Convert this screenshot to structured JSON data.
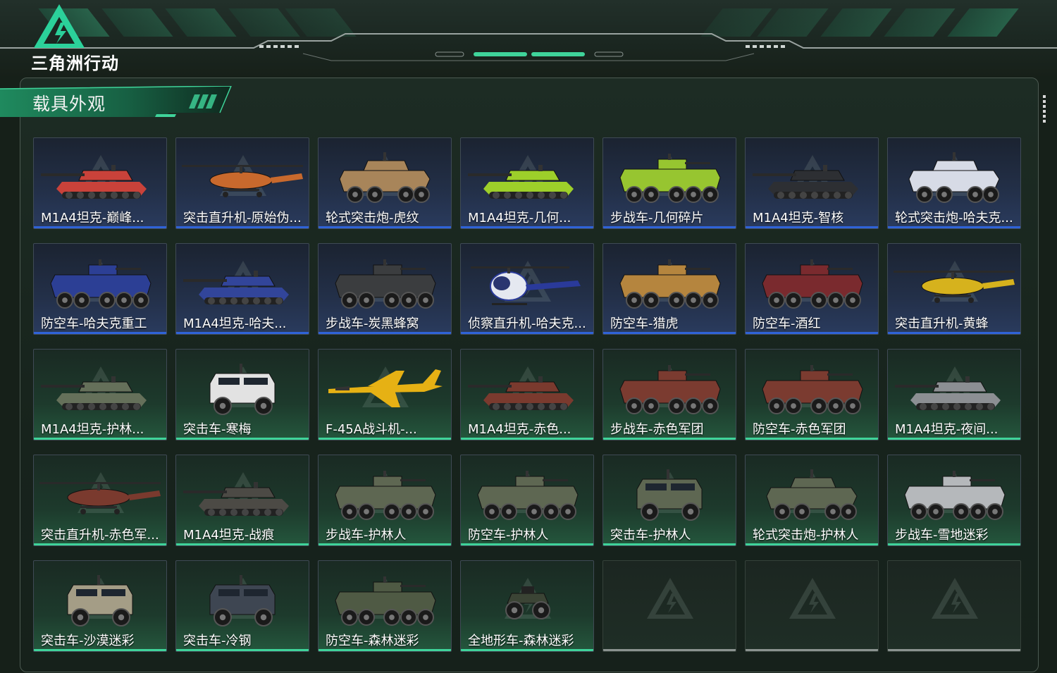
{
  "game": {
    "logo_text": "三角洲行动"
  },
  "panel": {
    "title": "载具外观"
  },
  "colors": {
    "rare_blue": "#2f63d8",
    "epic_green": "#3fd49a",
    "empty_gray": "#8b9390",
    "brand_green": "#2bd19a"
  },
  "vehicles": [
    {
      "name": "M1A4坦克-巅峰...",
      "rarity": "blue",
      "kind": "tank",
      "paint": "#c9423a"
    },
    {
      "name": "突击直升机-原始伪...",
      "rarity": "blue",
      "kind": "heli",
      "paint": "#c8692d"
    },
    {
      "name": "轮式突击炮-虎纹",
      "rarity": "blue",
      "kind": "wheeled4",
      "paint": "#a8855a"
    },
    {
      "name": "M1A4坦克-几何...",
      "rarity": "blue",
      "kind": "tank",
      "paint": "#9dcf2a"
    },
    {
      "name": "步战车-几何碎片",
      "rarity": "blue",
      "kind": "apc",
      "paint": "#97c530"
    },
    {
      "name": "M1A4坦克-智核",
      "rarity": "blue",
      "kind": "tank",
      "paint": "#2d2f33"
    },
    {
      "name": "轮式突击炮-哈夫克...",
      "rarity": "blue",
      "kind": "wheeled4",
      "paint": "#d7dbe6"
    },
    {
      "name": "防空车-哈夫克重工",
      "rarity": "blue",
      "kind": "apc",
      "paint": "#2c3f95"
    },
    {
      "name": "M1A4坦克-哈夫...",
      "rarity": "blue",
      "kind": "tank",
      "paint": "#32459a"
    },
    {
      "name": "步战车-炭黑蜂窝",
      "rarity": "blue",
      "kind": "apc",
      "paint": "#3b3d3f"
    },
    {
      "name": "侦察直升机-哈夫克...",
      "rarity": "blue",
      "kind": "scout",
      "paint": "#e5e8f0"
    },
    {
      "name": "防空车-猎虎",
      "rarity": "blue",
      "kind": "apc",
      "paint": "#b5853e"
    },
    {
      "name": "防空车-酒红",
      "rarity": "blue",
      "kind": "apc",
      "paint": "#7a2a2e"
    },
    {
      "name": "突击直升机-黄蜂",
      "rarity": "blue",
      "kind": "heli",
      "paint": "#d6b21d"
    },
    {
      "name": "M1A4坦克-护林...",
      "rarity": "green",
      "kind": "tank",
      "paint": "#65705a"
    },
    {
      "name": "突击车-寒梅",
      "rarity": "green",
      "kind": "truck",
      "paint": "#e2e2e2"
    },
    {
      "name": "F-45A战斗机-...",
      "rarity": "green",
      "kind": "jet",
      "paint": "#e6b114"
    },
    {
      "name": "M1A4坦克-赤色...",
      "rarity": "green",
      "kind": "tank",
      "paint": "#7a3a2e"
    },
    {
      "name": "步战车-赤色军团",
      "rarity": "green",
      "kind": "apc",
      "paint": "#7b3b30"
    },
    {
      "name": "防空车-赤色军团",
      "rarity": "green",
      "kind": "apc",
      "paint": "#7b3b30"
    },
    {
      "name": "M1A4坦克-夜间...",
      "rarity": "green",
      "kind": "tank",
      "paint": "#8c8f93"
    },
    {
      "name": "突击直升机-赤色军...",
      "rarity": "green",
      "kind": "heli",
      "paint": "#7a3a2e"
    },
    {
      "name": "M1A4坦克-战痕",
      "rarity": "green",
      "kind": "tank",
      "paint": "#4c4a45"
    },
    {
      "name": "步战车-护林人",
      "rarity": "green",
      "kind": "apc",
      "paint": "#5e6752"
    },
    {
      "name": "防空车-护林人",
      "rarity": "green",
      "kind": "apc",
      "paint": "#5e6752"
    },
    {
      "name": "突击车-护林人",
      "rarity": "green",
      "kind": "truck",
      "paint": "#5e6752"
    },
    {
      "name": "轮式突击炮-护林人",
      "rarity": "green",
      "kind": "wheeled4",
      "paint": "#5e6752"
    },
    {
      "name": "步战车-雪地迷彩",
      "rarity": "green",
      "kind": "apc",
      "paint": "#b5b8bb"
    },
    {
      "name": "突击车-沙漠迷彩",
      "rarity": "green",
      "kind": "truck",
      "paint": "#a49d86"
    },
    {
      "name": "突击车-冷钢",
      "rarity": "green",
      "kind": "truck",
      "paint": "#3e4652"
    },
    {
      "name": "防空车-森林迷彩",
      "rarity": "green",
      "kind": "apc",
      "paint": "#4f5a44"
    },
    {
      "name": "全地形车-森林迷彩",
      "rarity": "green",
      "kind": "atv",
      "paint": "#3b4435"
    },
    {
      "name": "",
      "rarity": "empty",
      "kind": "none",
      "paint": ""
    },
    {
      "name": "",
      "rarity": "empty",
      "kind": "none",
      "paint": ""
    },
    {
      "name": "",
      "rarity": "empty",
      "kind": "none",
      "paint": ""
    }
  ]
}
